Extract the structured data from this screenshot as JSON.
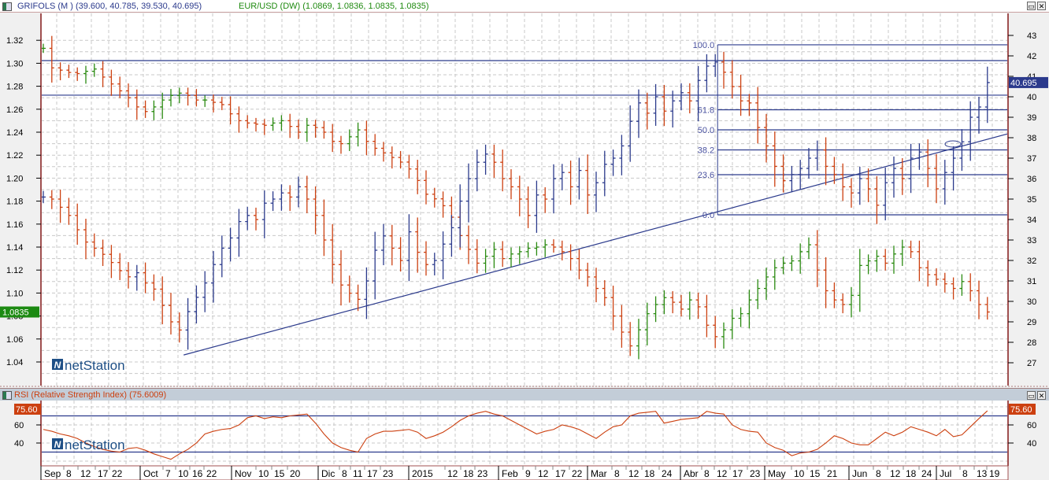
{
  "header": {
    "main_series": "GRIFOLS (M ) (39.600, 40.785, 39.530, 40.695)",
    "overlay_series": "EUR/USD (DW) (1.0869, 1.0836, 1.0835, 1.0835)",
    "rsi_title": "RSI (Relative Strength Index) (75.6009)",
    "maximize": "▭",
    "close": "✕"
  },
  "watermark": {
    "brand_mark": "N",
    "brand": "netStation"
  },
  "colors": {
    "up_main": "#2b3a8c",
    "down": "#cc4010",
    "up_overlay": "#2a8a10",
    "lines": "#2b3a8c",
    "rsi": "#cc4010",
    "frame": "#a05050"
  },
  "chart_data": [
    {
      "type": "ohlc",
      "title": "GRIFOLS (M )",
      "axis": "right",
      "ylim": [
        26.5,
        43.5
      ],
      "yticks": [
        "43",
        "42",
        "41",
        "40",
        "39",
        "38",
        "37",
        "36",
        "35",
        "34",
        "33",
        "32",
        "31",
        "30",
        "29",
        "28",
        "27"
      ],
      "last_value": "40.695",
      "closes": [
        35.1,
        35.0,
        34.6,
        34.2,
        33.5,
        32.9,
        32.6,
        32.3,
        31.9,
        31.5,
        31.2,
        31.4,
        30.9,
        30.6,
        29.8,
        29.0,
        28.6,
        29.5,
        30.2,
        30.9,
        31.8,
        32.6,
        33.1,
        33.9,
        34.2,
        34.0,
        34.8,
        35.0,
        35.3,
        35.1,
        35.6,
        35.0,
        34.2,
        33.0,
        31.8,
        30.8,
        30.4,
        30.1,
        31.0,
        32.5,
        33.2,
        32.6,
        32.0,
        33.4,
        32.4,
        31.8,
        32.0,
        32.8,
        33.6,
        34.9,
        36.0,
        36.8,
        37.2,
        36.8,
        36.0,
        35.6,
        35.0,
        34.2,
        35.2,
        35.0,
        36.0,
        36.3,
        35.6,
        36.4,
        35.2,
        35.8,
        36.7,
        37.0,
        37.6,
        38.8,
        39.7,
        39.2,
        40.0,
        39.3,
        39.8,
        40.2,
        39.8,
        40.8,
        41.5,
        41.7,
        41.2,
        40.5,
        39.8,
        39.7,
        38.5,
        37.6,
        36.6,
        35.9,
        36.2,
        36.5,
        37.0,
        37.4,
        36.6,
        36.2,
        35.6,
        35.3,
        36.0,
        35.5,
        34.7,
        35.8,
        36.5,
        36.0,
        37.0,
        37.3,
        36.5,
        35.5,
        36.3,
        37.0,
        37.8,
        39.0,
        39.5,
        40.695
      ],
      "horizontal_lines": [
        41.77,
        40.08
      ],
      "trendline": {
        "from": [
          16.5,
          27.38
        ],
        "to": [
          113.4,
          38.19
        ]
      },
      "fibonacci": {
        "high": 42.54,
        "low": 34.23,
        "start_bar": 79,
        "levels": [
          {
            "pct": 100.0,
            "label": "100.0"
          },
          {
            "pct": 61.8,
            "label": "61.8"
          },
          {
            "pct": 50.0,
            "label": "50.0"
          },
          {
            "pct": 38.2,
            "label": "38.2"
          },
          {
            "pct": 23.6,
            "label": "23.6"
          },
          {
            "pct": 0.0,
            "label": "0.0"
          }
        ]
      }
    },
    {
      "type": "ohlc",
      "title": "EUR/USD (DW)",
      "axis": "left",
      "ylim": [
        1.02,
        1.33
      ],
      "yticks": [
        "1.32",
        "1.30",
        "1.28",
        "1.26",
        "1.24",
        "1.22",
        "1.20",
        "1.18",
        "1.16",
        "1.14",
        "1.12",
        "1.10",
        "1.08",
        "1.06",
        "1.04"
      ],
      "last_value": "1.0835",
      "closes": [
        1.313,
        1.296,
        1.294,
        1.292,
        1.291,
        1.293,
        1.295,
        1.288,
        1.282,
        1.276,
        1.27,
        1.262,
        1.258,
        1.262,
        1.268,
        1.272,
        1.274,
        1.272,
        1.268,
        1.268,
        1.266,
        1.264,
        1.256,
        1.25,
        1.248,
        1.247,
        1.246,
        1.248,
        1.25,
        1.245,
        1.24,
        1.246,
        1.244,
        1.24,
        1.232,
        1.23,
        1.236,
        1.242,
        1.232,
        1.226,
        1.222,
        1.218,
        1.214,
        1.208,
        1.198,
        1.186,
        1.182,
        1.176,
        1.166,
        1.15,
        1.138,
        1.126,
        1.132,
        1.138,
        1.13,
        1.134,
        1.136,
        1.139,
        1.14,
        1.142,
        1.14,
        1.136,
        1.13,
        1.12,
        1.114,
        1.104,
        1.096,
        1.08,
        1.066,
        1.054,
        1.068,
        1.082,
        1.09,
        1.096,
        1.092,
        1.086,
        1.094,
        1.088,
        1.072,
        1.062,
        1.068,
        1.078,
        1.082,
        1.094,
        1.104,
        1.114,
        1.122,
        1.126,
        1.128,
        1.136,
        1.142,
        1.12,
        1.102,
        1.094,
        1.09,
        1.098,
        1.124,
        1.128,
        1.132,
        1.126,
        1.134,
        1.14,
        1.136,
        1.122,
        1.116,
        1.112,
        1.108,
        1.104,
        1.11,
        1.102,
        1.09,
        1.0835
      ]
    },
    {
      "type": "line",
      "title": "RSI (Relative Strength Index)",
      "ylim": [
        17,
        86
      ],
      "yticks": [
        "60",
        "40"
      ],
      "bands": [
        70,
        30
      ],
      "last_value": "75.60",
      "values": [
        55,
        53,
        50,
        48,
        45,
        40,
        36,
        33,
        31,
        30,
        34,
        35,
        32,
        28,
        25,
        22,
        28,
        33,
        40,
        50,
        53,
        55,
        56,
        60,
        68,
        70,
        67,
        69,
        68,
        70,
        71,
        72,
        62,
        50,
        40,
        35,
        32,
        30,
        45,
        50,
        53,
        53,
        54,
        55,
        52,
        45,
        48,
        52,
        58,
        65,
        70,
        73,
        75,
        72,
        70,
        65,
        60,
        55,
        50,
        53,
        55,
        60,
        58,
        55,
        50,
        45,
        52,
        58,
        60,
        70,
        73,
        74,
        75,
        62,
        64,
        66,
        67,
        68,
        75,
        73,
        72,
        60,
        55,
        53,
        52,
        40,
        35,
        32,
        26,
        29,
        30,
        33,
        40,
        48,
        45,
        40,
        38,
        38,
        45,
        52,
        48,
        52,
        58,
        55,
        52,
        48,
        55,
        47,
        49,
        58,
        67,
        75.6
      ]
    }
  ],
  "x_axis": {
    "labels": [
      "Sep",
      "8",
      "12",
      "17",
      "22",
      "Oct",
      "7",
      "10",
      "16",
      "22",
      "Nov",
      "10",
      "15",
      "20",
      "Dic",
      "8",
      "11",
      "17",
      "23",
      "2015",
      "12",
      "18",
      "23",
      "Feb",
      "9",
      "12",
      "17",
      "22",
      "Mar",
      "8",
      "12",
      "18",
      "24",
      "Abr",
      "8",
      "12",
      "17",
      "23",
      "May",
      "10",
      "15",
      "21",
      "Jun",
      "8",
      "12",
      "18",
      "24",
      "Jul",
      "8",
      "13",
      "19"
    ]
  }
}
